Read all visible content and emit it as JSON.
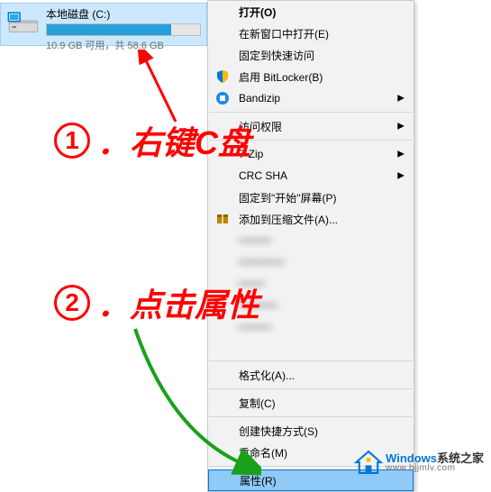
{
  "drive": {
    "label": "本地磁盘 (C:)",
    "status": "10.9 GB 可用，共 58.6 GB",
    "used_percent": 81
  },
  "menu": {
    "open": "打开(O)",
    "open_new_window": "在新窗口中打开(E)",
    "pin_quick_access": "固定到快速访问",
    "bitlocker": "启用 BitLocker(B)",
    "bandizip": "Bandizip",
    "access_perm": "访问权限",
    "seven_zip": "7-Zip",
    "crc_sha": "CRC SHA",
    "pin_start": "固定到\"开始\"屏幕(P)",
    "add_compress": "添加到压缩文件(A)...",
    "format": "格式化(A)...",
    "copy": "复制(C)",
    "create_shortcut": "创建快捷方式(S)",
    "rename": "重命名(M)",
    "properties": "属性(R)"
  },
  "annotations": {
    "step1_num": "1",
    "step1_text": "．右键C盘",
    "step2_num": "2",
    "step2_text": "．点击属性"
  },
  "watermark": {
    "brand": "Windows",
    "brand_cn": "系统之家",
    "url": "www.bjjmlv.com"
  }
}
